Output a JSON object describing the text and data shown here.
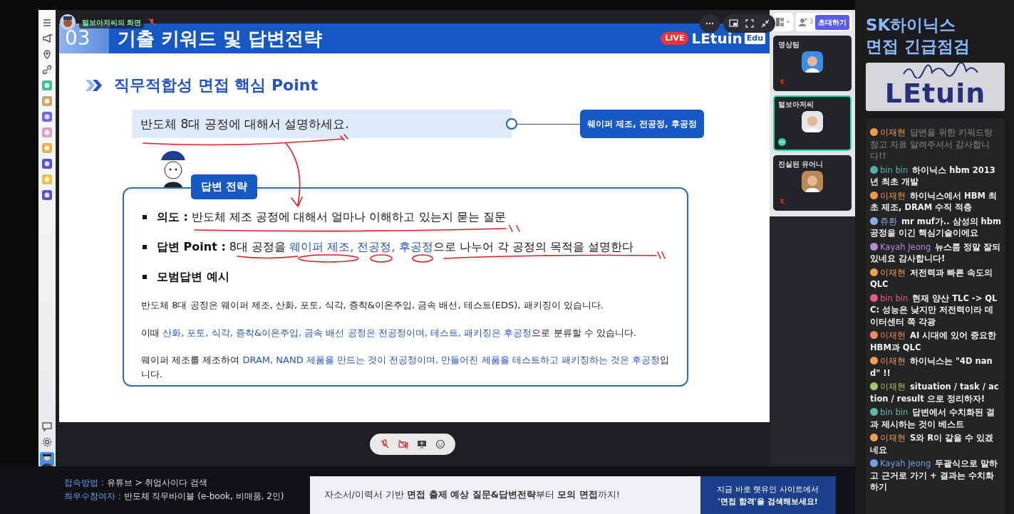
{
  "screen_share": {
    "presenter_label": "털보아저씨의 화면"
  },
  "slide": {
    "section_number": "03",
    "title": "기출 키워드 및 답변전략",
    "live_badge": "LIVE",
    "brand": "LEtuin",
    "brand_tag": "Edu",
    "subtitle": "직무적합성 면접 핵심 Point",
    "question": "반도체 8대 공정에 대해서 설명하세요.",
    "keyword_pill": "웨이퍼 제조, 전공정, 후공정",
    "strategy_tag": "답변 전략",
    "bullets": [
      {
        "label": "의도 :",
        "segments": [
          {
            "text": " 반도체 제조 공정에 대해서 얼마나 이해하고 있는지 묻는 질문",
            "emphasis": false
          }
        ]
      },
      {
        "label": "답변 Point :",
        "segments": [
          {
            "text": " 8대 공정을 ",
            "emphasis": false
          },
          {
            "text": "웨이퍼 제조, 전공정, 후공정",
            "emphasis": true
          },
          {
            "text": "으로 나누어 각 공정의 목적을 설명한다",
            "emphasis": false
          }
        ]
      },
      {
        "label": "모범답변 예시"
      }
    ],
    "sample_lines": [
      [
        {
          "text": "반도체 8대 공정은 웨이퍼 제조, 산화, 포토, 식각, 증착&이온주입, 금속 배선, 테스트(EDS), 패키징이 있습니다.",
          "emphasis": false
        }
      ],
      [
        {
          "text": "이때 ",
          "emphasis": false
        },
        {
          "text": "산화, 포토, 식각, 증착&이온주입, 금속 배선 공정은 전공정이며, 테스트, 패키징은 후공정",
          "emphasis": true
        },
        {
          "text": "으로 분류할 수 있습니다.",
          "emphasis": false
        }
      ],
      [
        {
          "text": "웨이퍼 제조를 제조하여 ",
          "emphasis": false
        },
        {
          "text": "DRAM, NAND 제품을 만드는 것이 전공정이며, 만들어진 제품을 테스트하고 패키징하는 것은 후공정",
          "emphasis": true
        },
        {
          "text": "입니다.",
          "emphasis": false
        }
      ]
    ]
  },
  "participants": {
    "count": "3",
    "invite_button": "초대하기",
    "tiles": [
      {
        "name": "영상팀",
        "speaking": false
      },
      {
        "name": "털보아저씨",
        "speaking": true
      },
      {
        "name": "진실된 유어니",
        "speaking": false
      }
    ]
  },
  "chat": {
    "title_lines": [
      "SK하이닉스",
      "면접 긴급점검"
    ],
    "logo_text": "LEtuin",
    "messages": [
      {
        "author": "이재현",
        "color": "#f09a4a",
        "text": "답변을 위한 키워드랑 참고 자료 알려주셔서 감사합니다!!",
        "faded": true
      },
      {
        "author": "bin bin",
        "color": "#4fb3a9",
        "text": "하이닉스 hbm 2013년 최초 개발",
        "faded": false
      },
      {
        "author": "이재현",
        "color": "#f09a4a",
        "text": "하이닉스에서 HBM 최초 제조, DRAM 수직 적층",
        "faded": false
      },
      {
        "author": "쥬환",
        "color": "#7fb0e0",
        "text": "mr muf가.. 삼성의 hbm공정을 이긴 핵심기술이에요",
        "faded": false
      },
      {
        "author": "Kayah Jeong",
        "color": "#b48ad9",
        "text": "뉴스룸 정말 잘되있네요 감사합니다!",
        "faded": false
      },
      {
        "author": "이재현",
        "color": "#f0a050",
        "text": "저전력과 빠른 속도의 QLC",
        "faded": false
      },
      {
        "author": "bin bin",
        "color": "#e0607e",
        "text": "현재 양산 TLC -> QLC: 성능은 낮지만 저전력이라 데이터센터 쪽 각광",
        "faded": false
      },
      {
        "author": "이재현",
        "color": "#f08a5a",
        "text": "AI 시대에 있어 중요한 HBM과 QLC",
        "faded": false
      },
      {
        "author": "이재현",
        "color": "#f0a050",
        "text": "하이닉스는 \"4D nand\" !!",
        "faded": false
      },
      {
        "author": "이재현",
        "color": "#a8c86a",
        "text": "situation / task / action / result 으로 정리하자!",
        "faded": false
      },
      {
        "author": "bin bin",
        "color": "#5fb8a8",
        "text": "답변에서 수치화된 결과 제시하는 것이 베스트",
        "faded": false
      },
      {
        "author": "이재현",
        "color": "#f0a050",
        "text": "S와 R이 같을 수 있겠네요",
        "faded": false
      },
      {
        "author": "Kayah Jeong",
        "color": "#6fa0e0",
        "text": "두괄식으로 말하고 근거로 가기 + 결과는 수치화하기",
        "faded": false
      }
    ]
  },
  "footer": {
    "info_lines": [
      {
        "label": "접속방법 :",
        "value": "유튜브 > 취업사이다 검색"
      },
      {
        "label": "최우수참여자 :",
        "value": "반도체 직무바이블 (e-book, 비매품, 2인)"
      }
    ],
    "banner": {
      "headline": "자소서/이력서 기반 **면접 출제 예상 질문&답변전략**부터 **모의 면접**까지!",
      "cta_lines": [
        "지금 바로 렛유인 사이트에서",
        "'면접 합격'을 검색해보세요!"
      ]
    }
  }
}
